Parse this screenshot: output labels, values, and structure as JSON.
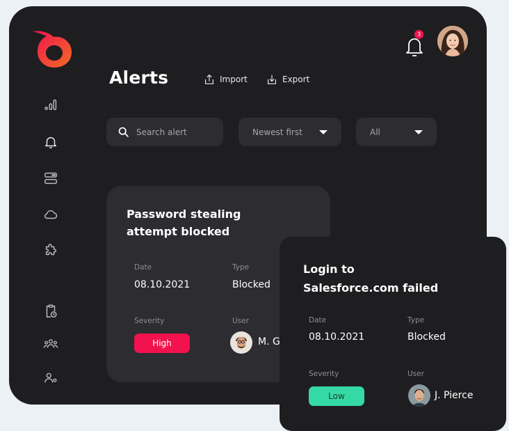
{
  "header": {
    "title": "Alerts",
    "import_label": "Import",
    "export_label": "Export",
    "notification_count": "3"
  },
  "filters": {
    "search_placeholder": "Search alert",
    "sort_value": "Newest first",
    "status_value": "All"
  },
  "sidebar": {
    "items": [
      {
        "icon": "bar-chart-icon"
      },
      {
        "icon": "bell-icon"
      },
      {
        "icon": "server-icon"
      },
      {
        "icon": "cloud-icon"
      },
      {
        "icon": "puzzle-icon"
      },
      {
        "icon": "clipboard-clock-icon"
      },
      {
        "icon": "users-icon"
      },
      {
        "icon": "user-settings-icon"
      }
    ]
  },
  "alerts": [
    {
      "title_line1": "Password stealing",
      "title_line2": "attempt blocked",
      "date_label": "Date",
      "date": "08.10.2021",
      "type_label": "Type",
      "type": "Blocked",
      "severity_label": "Severity",
      "severity": "High",
      "user_label": "User",
      "user": "M. G"
    },
    {
      "title_line1": "Login to",
      "title_line2": "Salesforce.com failed",
      "date_label": "Date",
      "date": "08.10.2021",
      "type_label": "Type",
      "type": "Blocked",
      "severity_label": "Severity",
      "severity": "Low",
      "user_label": "User",
      "user": "J. Pierce"
    }
  ],
  "colors": {
    "accent_red": "#f2124d",
    "accent_green": "#35d9a4",
    "brand_orange": "#f04a2c"
  }
}
